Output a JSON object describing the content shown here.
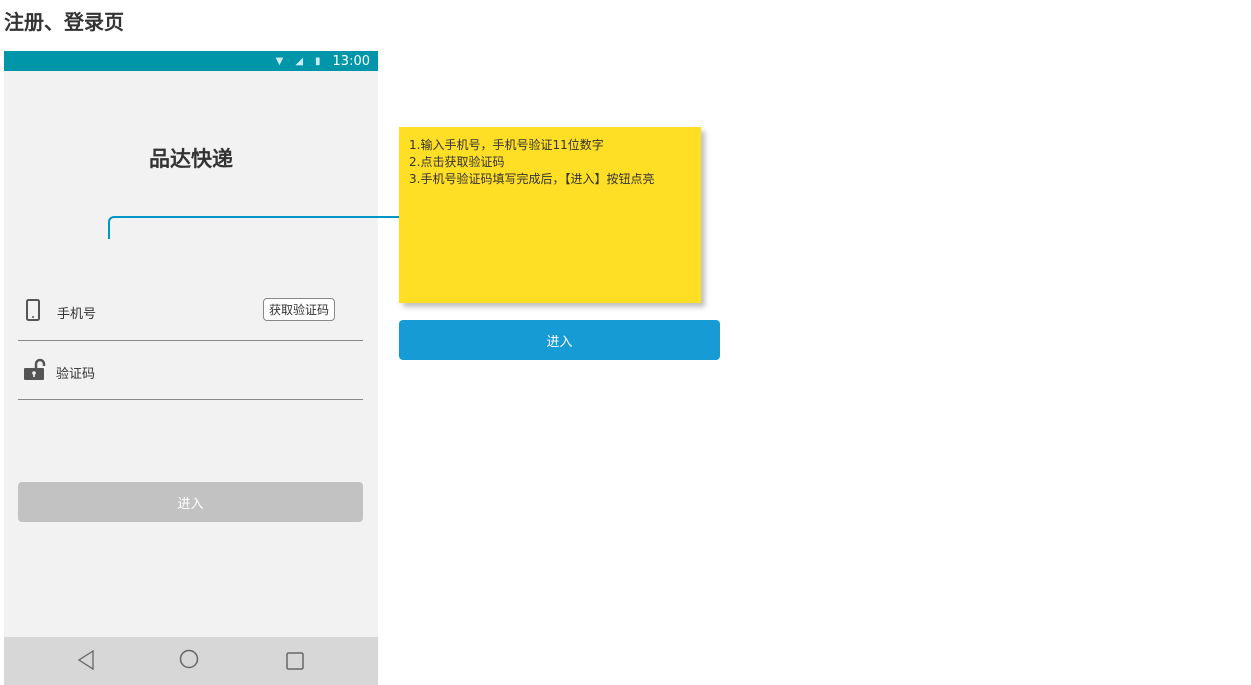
{
  "page_title": "注册、登录页",
  "status_bar": {
    "time": "13:00",
    "icons": [
      "wifi-icon",
      "signal-icon",
      "battery-icon"
    ],
    "color": "#0096aa"
  },
  "app": {
    "name": "品达快递"
  },
  "form": {
    "phone_placeholder": "手机号",
    "get_code_label": "获取验证码",
    "code_placeholder": "验证码",
    "enter_label": "进入"
  },
  "nav": [
    "back-icon",
    "home-icon",
    "recents-icon"
  ],
  "note": {
    "lines": [
      "1.输入手机号，手机号验证11位数字",
      "2.点击获取验证码",
      "3.手机号验证码填写完成后，【进入】按钮点亮"
    ],
    "color": "#ffdf25"
  },
  "enter_active": {
    "label": "进入",
    "color": "#169bd5"
  }
}
